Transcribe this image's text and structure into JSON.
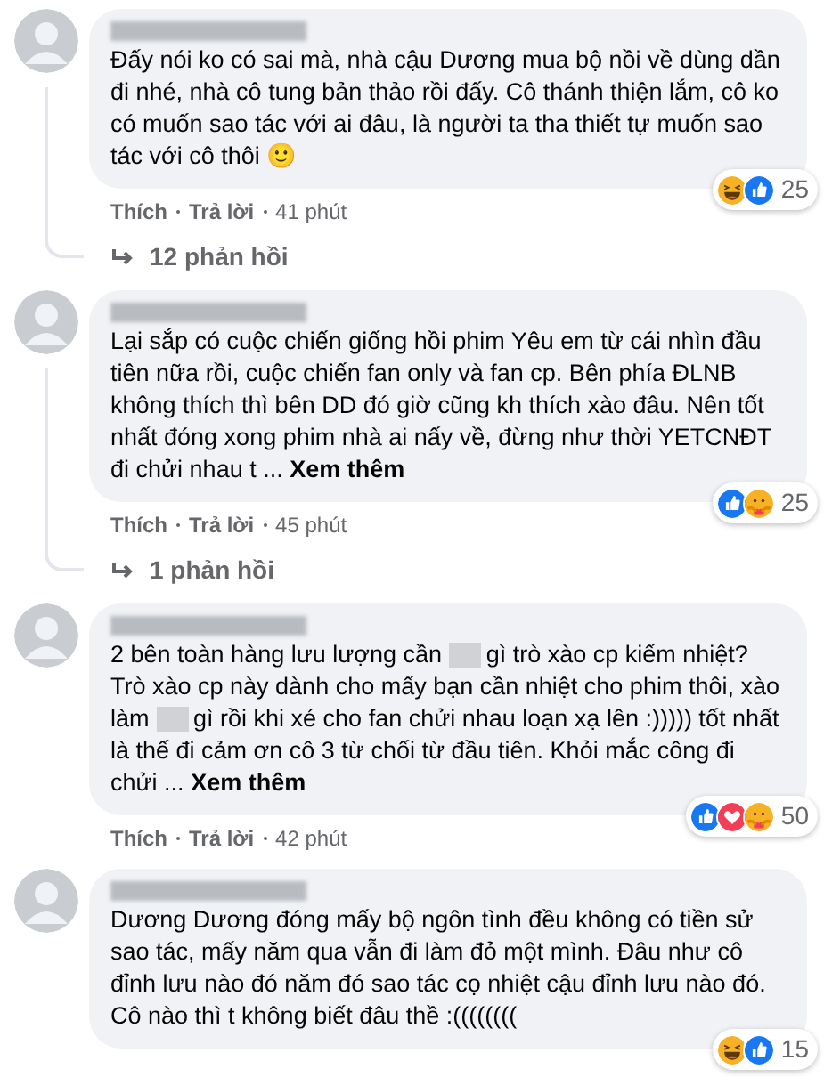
{
  "comments": [
    {
      "name_hidden": true,
      "body": [
        {
          "kind": "text",
          "text": "Đấy nói ko có sai mà, nhà cậu Dương mua bộ nồi về dùng dần đi nhé, nhà cô tung bản thảo rồi đấy. Cô thánh thiện lắm, cô ko có muốn sao tác với ai đâu, là người ta tha thiết tự muốn sao tác với cô thôi 🙂"
        }
      ],
      "reactions": [
        {
          "kind": "haha"
        },
        {
          "kind": "like"
        }
      ],
      "reaction_count": "25",
      "actions": [
        "Thích",
        "Trả lời"
      ],
      "time": "41 phút",
      "replies": "12 phản hồi"
    },
    {
      "name_hidden": true,
      "body": [
        {
          "kind": "text",
          "text": "Lại sắp có cuộc chiến giống hồi phim Yêu em từ cái nhìn đầu tiên nữa rồi, cuộc chiến fan only và fan cp. Bên phía ĐLNB không thích thì bên DD đó giờ cũng kh thích xào đâu. Nên tốt nhất đóng xong phim nhà ai nấy về, đừng như thời YETCNĐT đi chửi nhau t ..."
        }
      ],
      "more": "Xem thêm",
      "reactions": [
        {
          "kind": "like"
        },
        {
          "kind": "care"
        }
      ],
      "reaction_count": "25",
      "actions": [
        "Thích",
        "Trả lời"
      ],
      "time": "45 phút",
      "replies": "1 phản hồi"
    },
    {
      "name_hidden": true,
      "body": [
        {
          "kind": "text",
          "text": "2 bên toàn hàng lưu lượng cần"
        },
        {
          "kind": "blur"
        },
        {
          "kind": "text",
          "text": "gì trò xào cp kiếm nhiệt? Trò xào cp này dành cho mấy bạn cần nhiệt cho phim thôi, xào làm"
        },
        {
          "kind": "blur"
        },
        {
          "kind": "text",
          "text": "gì rồi khi xé cho fan chửi nhau loạn xạ lên :))))) tốt nhất là thế đi cảm ơn cô 3 từ chối từ đầu tiên. Khỏi mắc công đi chửi ..."
        }
      ],
      "more": "Xem thêm",
      "reactions": [
        {
          "kind": "like"
        },
        {
          "kind": "love"
        },
        {
          "kind": "care"
        }
      ],
      "reaction_count": "50",
      "actions": [
        "Thích",
        "Trả lời"
      ],
      "time": "42 phút"
    },
    {
      "name_hidden": true,
      "body": [
        {
          "kind": "text",
          "text": "Dương Dương đóng mấy bộ ngôn tình đều không có tiền sử sao tác, mấy năm qua vẫn đi làm đỏ một mình. Đâu như cô đỉnh lưu nào đó năm đó sao tác cọ nhiệt cậu đỉnh lưu nào đó. Cô nào thì t không biết đâu thề :(((((((("
        }
      ],
      "reactions": [
        {
          "kind": "haha"
        },
        {
          "kind": "like"
        }
      ],
      "reaction_count": "15"
    }
  ]
}
